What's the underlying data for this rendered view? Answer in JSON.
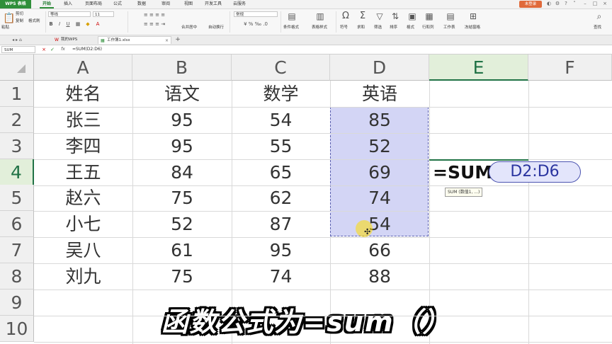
{
  "app": {
    "name": "WPS 表格",
    "login_label": "未登录"
  },
  "ribbon_tabs": [
    "开始",
    "插入",
    "页面布局",
    "公式",
    "数据",
    "审阅",
    "视图",
    "开发工具",
    "云服务"
  ],
  "ribbon": {
    "cut": "剪切",
    "paste": "粘贴",
    "copy": "复制",
    "format_painter": "格式刷",
    "font_name": "等线",
    "font_size": "11",
    "merge_center": "合并居中",
    "wrap_text": "自动换行",
    "number_format": "常规",
    "conditional_format": "条件格式",
    "table_style": "表格样式",
    "symbol": "符号",
    "sum": "求和",
    "filter": "筛选",
    "sort": "排序",
    "format": "格式",
    "row_col": "行和列",
    "worksheet": "工作表",
    "freeze": "冻结窗格",
    "find": "查找"
  },
  "doc_tabs": [
    {
      "label": "我的WPS"
    },
    {
      "label": "工作簿1.xlsx"
    }
  ],
  "formula_bar": {
    "name_box": "SUM",
    "fx": "fx",
    "content": "=SUM(D2:D6)"
  },
  "columns": [
    "A",
    "B",
    "C",
    "D",
    "E",
    "F"
  ],
  "rows": [
    "1",
    "2",
    "3",
    "4",
    "5",
    "6",
    "7",
    "8",
    "9",
    "10"
  ],
  "table": [
    [
      "姓名",
      "语文",
      "数学",
      "英语"
    ],
    [
      "张三",
      "95",
      "54",
      "85"
    ],
    [
      "李四",
      "95",
      "55",
      "52"
    ],
    [
      "王五",
      "84",
      "65",
      "69"
    ],
    [
      "赵六",
      "75",
      "62",
      "74"
    ],
    [
      "小七",
      "52",
      "87",
      "54"
    ],
    [
      "吴八",
      "61",
      "95",
      "66"
    ],
    [
      "刘九",
      "75",
      "74",
      "88"
    ]
  ],
  "active_cell": {
    "formula_prefix": "=SUM",
    "reference": "D2:D6"
  },
  "tooltip": "SUM (数值1, ...)",
  "subtitle": "函数公式为=sum（）"
}
